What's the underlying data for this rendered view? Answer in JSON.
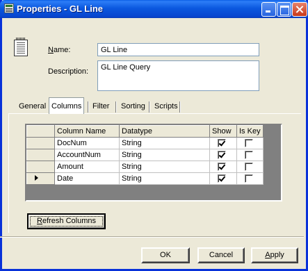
{
  "window": {
    "title": "Properties - GL Line",
    "icon": "app-grid-icon"
  },
  "form": {
    "name_label_first": "N",
    "name_label_rest": "ame:",
    "name_value": "GL Line",
    "description_label": "Description:",
    "description_value": "GL Line Query"
  },
  "tabs": [
    {
      "label": "General"
    },
    {
      "label": "Columns",
      "active": true
    },
    {
      "label": "Filter"
    },
    {
      "label": "Sorting"
    },
    {
      "label": "Scripts"
    }
  ],
  "grid": {
    "headers": [
      "Column Name",
      "Datatype",
      "Show",
      "Is Key"
    ],
    "rows": [
      {
        "name": "DocNum",
        "type": "String",
        "show": true,
        "is_key": false,
        "current": false
      },
      {
        "name": "AccountNum",
        "type": "String",
        "show": true,
        "is_key": false,
        "current": false
      },
      {
        "name": "Amount",
        "type": "String",
        "show": true,
        "is_key": false,
        "current": false
      },
      {
        "name": "Date",
        "type": "String",
        "show": true,
        "is_key": false,
        "current": true
      }
    ]
  },
  "buttons": {
    "refresh_first": "R",
    "refresh_rest": "efresh Columns",
    "ok": "OK",
    "cancel": "Cancel",
    "apply_first": "A",
    "apply_rest": "pply"
  }
}
